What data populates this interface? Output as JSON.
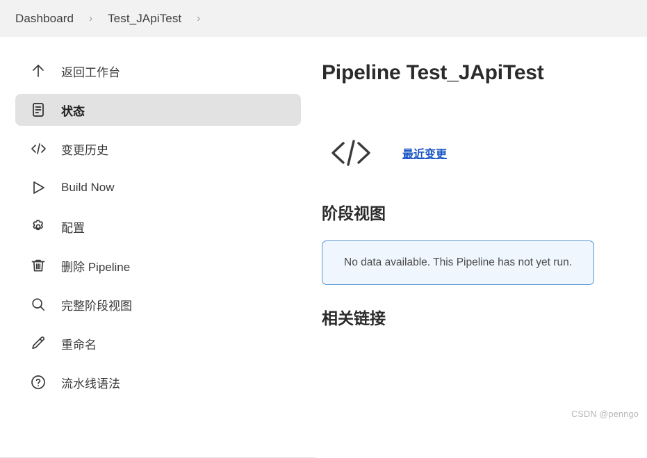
{
  "breadcrumb": {
    "items": [
      {
        "label": "Dashboard"
      },
      {
        "label": "Test_JApiTest"
      }
    ],
    "separator": "›"
  },
  "sidebar": {
    "items": [
      {
        "label": "返回工作台",
        "icon": "arrow-up-icon",
        "selected": false
      },
      {
        "label": "状态",
        "icon": "document-status-icon",
        "selected": true
      },
      {
        "label": "变更历史",
        "icon": "code-brackets-icon",
        "selected": false
      },
      {
        "label": "Build Now",
        "icon": "play-triangle-icon",
        "selected": false
      },
      {
        "label": "配置",
        "icon": "gear-icon",
        "selected": false
      },
      {
        "label": "删除 Pipeline",
        "icon": "trash-icon",
        "selected": false
      },
      {
        "label": "完整阶段视图",
        "icon": "search-icon",
        "selected": false
      },
      {
        "label": "重命名",
        "icon": "pencil-icon",
        "selected": false
      },
      {
        "label": "流水线语法",
        "icon": "help-circle-icon",
        "selected": false
      }
    ]
  },
  "main": {
    "title": "Pipeline Test_JApiTest",
    "recent_changes": {
      "icon": "code-brackets-icon",
      "link_label": "最近变更"
    },
    "stage_view": {
      "heading": "阶段视图",
      "empty_message": "No data available. This Pipeline has not yet run."
    },
    "related_links": {
      "heading": "相关链接"
    }
  },
  "watermark": "CSDN @penngo",
  "colors": {
    "header_bg": "#f2f2f2",
    "selected_bg": "#e2e2e2",
    "link_blue": "#1a56c4",
    "info_bg": "#eff6fd",
    "info_border": "#5596d8",
    "text": "#2f2f2f"
  }
}
